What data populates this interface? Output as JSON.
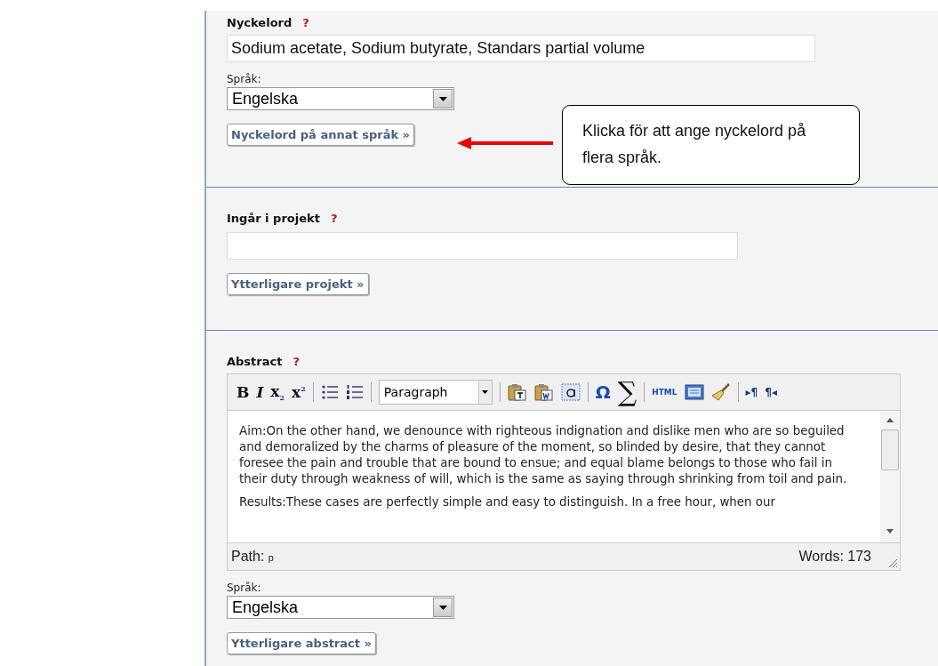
{
  "sections": [
    {
      "kind": "keywords",
      "title": "Nyckelord",
      "help": "?",
      "value": "Sodium acetate, Sodium butyrate, Standars partial volume",
      "language_label": "Språk:",
      "language": "Engelska",
      "button": "Nyckelord på annat språk »"
    },
    {
      "kind": "project",
      "title": "Ingår i projekt",
      "help": "?",
      "button": "Ytterligare projekt »"
    },
    {
      "kind": "abstract",
      "title": "Abstract",
      "help": "?",
      "editor": {
        "toolbar": [
          {
            "kind": "bold",
            "text": "B"
          },
          {
            "kind": "italic",
            "text": "I"
          },
          {
            "kind": "subscript",
            "text": "x$_{2}$"
          },
          {
            "kind": "superscript",
            "text": "x$^{2}$"
          },
          {
            "kind": "separator"
          },
          {
            "kind": "bullet-list"
          },
          {
            "kind": "numbered-list"
          },
          {
            "kind": "separator"
          },
          {
            "kind": "select",
            "text": "Paragraph"
          },
          {
            "kind": "separator"
          },
          {
            "kind": "paste-text"
          },
          {
            "kind": "paste-word"
          },
          {
            "kind": "select-all"
          },
          {
            "kind": "separator"
          },
          {
            "kind": "special-char",
            "text": "Ω"
          },
          {
            "kind": "math",
            "text": "∑"
          },
          {
            "kind": "separator"
          },
          {
            "kind": "html",
            "text": "HTML"
          },
          {
            "kind": "template"
          },
          {
            "kind": "cleanup"
          },
          {
            "kind": "separator"
          },
          {
            "kind": "ltr",
            "text": "▸¶"
          },
          {
            "kind": "rtl",
            "text": "¶◂"
          }
        ],
        "paragraphs": [
          "Aim:On the other hand, we denounce with righteous indignation and dislike men who are so beguiled and demoralized by the charms of pleasure of the moment, so blinded by desire, that they cannot foresee the pain and trouble that are bound to ensue; and equal blame belongs to those who fail in their duty through weakness of will, which is the same as saying through shrinking from toil and pain.",
          "Results:These cases are perfectly simple and easy to distinguish. In a free hour, when our"
        ],
        "path_label": "Path:",
        "path": "p",
        "words": "Words: 173"
      },
      "language_label": "Språk:",
      "language": "Engelska",
      "button": "Ytterligare abstract »"
    }
  ],
  "callout": {
    "text": "Klicka för att ange nyckelord på flera språk."
  }
}
